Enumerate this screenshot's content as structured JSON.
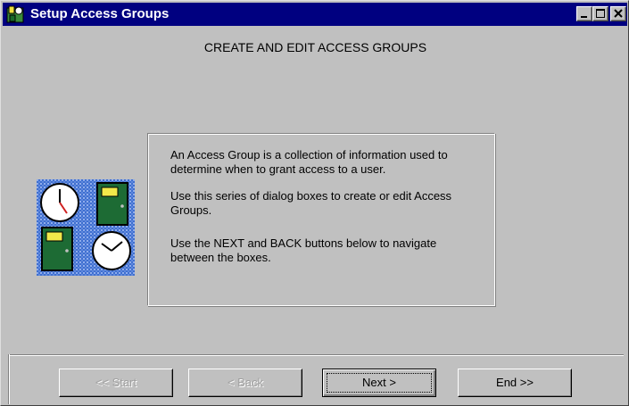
{
  "window": {
    "title": "Setup Access Groups",
    "title_bar_color": "#000080",
    "controls": [
      "minimize-icon",
      "maximize-icon",
      "close-icon"
    ]
  },
  "heading": "CREATE AND EDIT ACCESS GROUPS",
  "illustration": {
    "icons": [
      "clock-icon",
      "door-icon",
      "door-icon",
      "clock-icon"
    ]
  },
  "info": {
    "paragraph_1": "An Access Group is a collection of information used to determine when to grant access to a user.",
    "paragraph_2": "Use this series of dialog boxes to create or edit Access Groups.",
    "paragraph_3": "Use the NEXT and BACK buttons below to navigate between the boxes."
  },
  "buttons": {
    "start": {
      "label": "<< Start",
      "enabled": false
    },
    "back": {
      "label": "< Back",
      "enabled": false
    },
    "next": {
      "label": "Next >",
      "enabled": true,
      "focused": true
    },
    "end": {
      "label": "End >>",
      "enabled": true
    }
  }
}
